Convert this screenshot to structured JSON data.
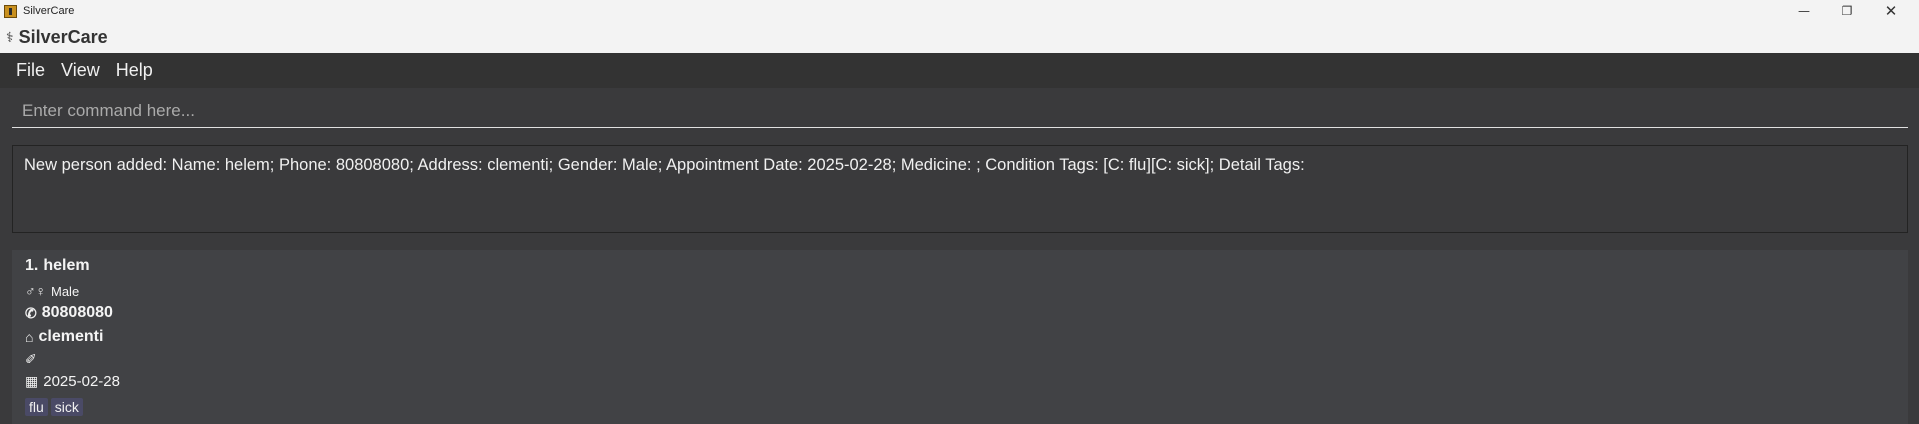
{
  "window": {
    "title": "SilverCare",
    "controls": [
      "minimize",
      "restore",
      "close"
    ]
  },
  "header": {
    "title": "SilverCare",
    "icon": "caduceus-icon"
  },
  "menu": {
    "file": "File",
    "view": "View",
    "help": "Help"
  },
  "command": {
    "placeholder": "Enter command here...",
    "value": ""
  },
  "result": {
    "text": "New person added: Name: helem; Phone: 80808080; Address: clementi; Gender: Male; Appointment Date: 2025-02-28; Medicine: ; Condition Tags: [C: flu][C: sick]; Detail Tags:"
  },
  "persons": [
    {
      "index": "1.",
      "name": "helem",
      "gender": "Male",
      "phone": "80808080",
      "address": "clementi",
      "medicine": "",
      "appointment_date": "2025-02-28",
      "tags": [
        "flu",
        "sick"
      ]
    }
  ],
  "colors": {
    "background": "#3a3a3c",
    "menubar": "#333333",
    "titlebar": "#f3f3f3",
    "card": "#414245",
    "tag": "#4a4a66",
    "text": "#f4f4f4"
  }
}
